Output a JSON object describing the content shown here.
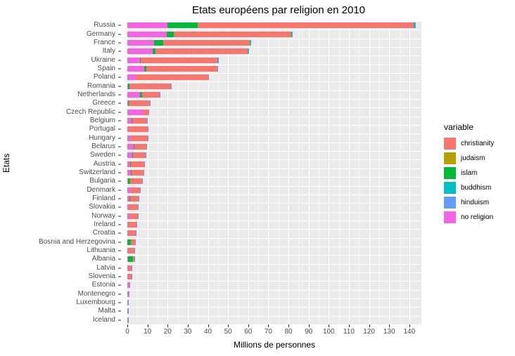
{
  "chart_data": {
    "type": "bar",
    "orientation": "horizontal",
    "stacked": true,
    "title": "Etats européens par religion en 2010",
    "xlabel": "Millions de personnes",
    "ylabel": "Etats",
    "legend_title": "variable",
    "legend_position": "right",
    "grid": true,
    "xlim": [
      0,
      146
    ],
    "xticks": [
      0,
      10,
      20,
      30,
      40,
      50,
      60,
      70,
      80,
      90,
      100,
      110,
      120,
      130,
      140
    ],
    "xtick_labels": [
      "0",
      "10",
      "20",
      "30",
      "40",
      "50",
      "60",
      "70",
      "80",
      "90",
      "100",
      "110",
      "120",
      "130",
      "140"
    ],
    "categories": [
      "Russia",
      "Germany",
      "France",
      "Italy",
      "Ukraine",
      "Spain",
      "Poland",
      "Romania",
      "Netherlands",
      "Greece",
      "Czech Republic",
      "Belgium",
      "Portugal",
      "Hungary",
      "Belarus",
      "Sweden",
      "Austria",
      "Switzerland",
      "Bulgaria",
      "Denmark",
      "Finland",
      "Slovakia",
      "Norway",
      "Ireland",
      "Croatia",
      "Bosnia and Herzegovina",
      "Lithuania",
      "Albania",
      "Latvia",
      "Slovenia",
      "Estonia",
      "Montenegro",
      "Luxembourg",
      "Malta",
      "Iceland"
    ],
    "series": [
      {
        "name": "no religion",
        "color": "#F564E3",
        "values": [
          20.0,
          19.7,
          13.2,
          12.4,
          6.4,
          8.3,
          3.8,
          0.3,
          6.4,
          0.3,
          7.8,
          2.0,
          0.4,
          1.8,
          3.3,
          2.5,
          1.3,
          1.7,
          0.3,
          1.6,
          1.2,
          0.8,
          1.0,
          0.3,
          0.2,
          0.1,
          0.3,
          0.3,
          0.4,
          0.4,
          0.7,
          0.02,
          0.1,
          0.01,
          0.02
        ]
      },
      {
        "name": "islam",
        "color": "#00BA38",
        "values": [
          15.0,
          3.5,
          4.7,
          1.6,
          0.4,
          1.0,
          0.02,
          0.7,
          0.9,
          0.5,
          0.005,
          0.6,
          0.02,
          0.03,
          0.02,
          0.4,
          0.5,
          0.4,
          1.0,
          0.2,
          0.04,
          0.004,
          0.1,
          0.04,
          0.06,
          1.6,
          0.003,
          2.6,
          0.002,
          0.05,
          0.002,
          0.1,
          0.01,
          0.002,
          0.001
        ]
      },
      {
        "name": "christianity",
        "color": "#F8766D",
        "values": [
          107.0,
          58.0,
          42.4,
          45.8,
          38.0,
          35.5,
          36.2,
          20.7,
          8.6,
          10.4,
          2.6,
          7.2,
          9.7,
          8.2,
          6.0,
          6.2,
          6.5,
          5.8,
          6.0,
          4.6,
          4.4,
          4.6,
          4.1,
          4.1,
          4.0,
          2.3,
          3.1,
          0.5,
          1.7,
          1.6,
          0.4,
          0.5,
          0.4,
          0.4,
          0.3
        ]
      },
      {
        "name": "judaism",
        "color": "#B79F00",
        "values": [
          0.2,
          0.3,
          0.5,
          0.03,
          0.07,
          0.01,
          0.003,
          0.01,
          0.03,
          0.004,
          0.004,
          0.03,
          0.002,
          0.05,
          0.001,
          0.02,
          0.01,
          0.02,
          0.002,
          0.006,
          0.001,
          0.003,
          0.001,
          0.001,
          0.002,
          0.001,
          0.003,
          0.0001,
          0.01,
          0.0001,
          0.002,
          0.0001,
          0.001,
          0.0001,
          0.0001
        ]
      },
      {
        "name": "buddhism",
        "color": "#00BFC4",
        "values": [
          0.7,
          0.3,
          0.3,
          0.1,
          0.06,
          0.05,
          0.003,
          0.003,
          0.03,
          0.004,
          0.003,
          0.01,
          0.003,
          0.004,
          0.002,
          0.04,
          0.02,
          0.04,
          0.001,
          0.01,
          0.002,
          0.002,
          0.01,
          0.004,
          0.002,
          0.0001,
          0.001,
          0.0001,
          0.0001,
          0.0001,
          0.0001,
          0.0001,
          0.0001,
          0.0001,
          0.0001
        ]
      },
      {
        "name": "hinduism",
        "color": "#619CFF",
        "values": [
          0.02,
          0.1,
          0.03,
          0.1,
          0.002,
          0.01,
          0.001,
          0.001,
          0.1,
          0.003,
          0.001,
          0.006,
          0.001,
          0.001,
          0.001,
          0.01,
          0.004,
          0.005,
          0.0005,
          0.004,
          0.001,
          0.0005,
          0.005,
          0.01,
          0.0005,
          0.0001,
          0.0005,
          0.0001,
          0.0005,
          0.0005,
          0.0005,
          0.0001,
          0.0005,
          0.0001,
          0.0001
        ]
      }
    ]
  },
  "legend": {
    "title": "variable",
    "items": [
      {
        "label": "christianity",
        "color": "#F8766D"
      },
      {
        "label": "judaism",
        "color": "#B79F00"
      },
      {
        "label": "islam",
        "color": "#00BA38"
      },
      {
        "label": "buddhism",
        "color": "#00BFC4"
      },
      {
        "label": "hinduism",
        "color": "#619CFF"
      },
      {
        "label": "no religion",
        "color": "#F564E3"
      }
    ]
  }
}
